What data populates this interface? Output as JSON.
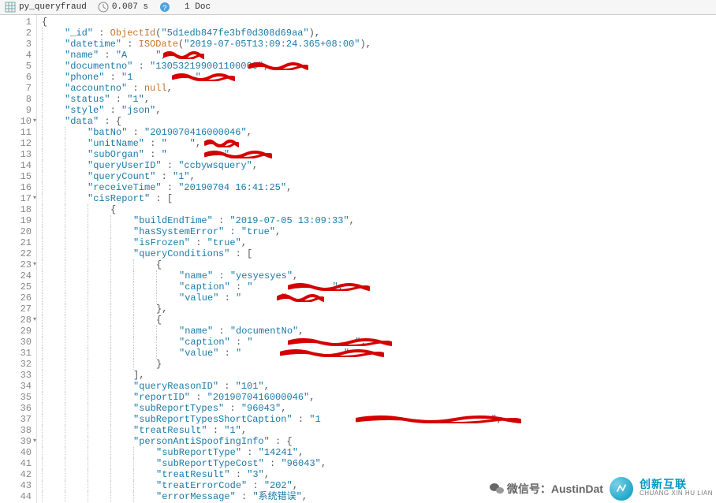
{
  "toolbar": {
    "query_name": "py_queryfraud",
    "time": "0.007 s",
    "doc_count": "1 Doc"
  },
  "code": {
    "json": {
      "_id": {
        "fn": "ObjectId",
        "arg": "5d1edb847fe3bf0d308d69aa"
      },
      "datetime": {
        "fn": "ISODate",
        "arg": "2019-07-05T13:09:24.365+08:00"
      },
      "name": "[REDACTED]",
      "documentno": "130532199001[REDACTED]",
      "phone": "1[REDACTED]",
      "accountno": null,
      "status": "1",
      "style": "json",
      "data": {
        "batNo": "2019070416000046",
        "unitName": "[REDACTED]",
        "subOrgan": "[REDACTED]",
        "queryUserID": "ccbywsquery",
        "queryCount": "1",
        "receiveTime": "20190704 16:41:25",
        "cisReport": [
          {
            "buildEndTime": "2019-07-05 13:09:33",
            "hasSystemError": "true",
            "isFrozen": "true",
            "queryConditions": [
              {
                "name": "yesyesyes",
                "caption": "[REDACTED]",
                "value": "[REDACTED]"
              },
              {
                "name": "documentNo",
                "caption": "[REDACTED]",
                "value": "[REDACTED]"
              }
            ],
            "queryReasonID": "101",
            "reportID": "2019070416000046",
            "subReportTypes": "96043",
            "subReportTypesShortCaption": "1[REDACTED]",
            "treatResult": "1",
            "personAntiSpoofingInfo": {
              "subReportType": "14241",
              "subReportTypeCost": "96043",
              "treatResult": "3",
              "treatErrorCode": "202",
              "errorMessage": "系统错误"
            }
          }
        ]
      }
    }
  },
  "folds": [
    10,
    17,
    23,
    28,
    39
  ],
  "overlay": {
    "wechat_label": "微信号：AustinDat",
    "brand_big": "创新互联",
    "brand_small": "CHUANG XIN HU LIAN"
  },
  "colors": {
    "key": "#1a7aa8",
    "fn": "#c97427",
    "punct": "#555",
    "gutter": "#888"
  },
  "chart_data": null
}
